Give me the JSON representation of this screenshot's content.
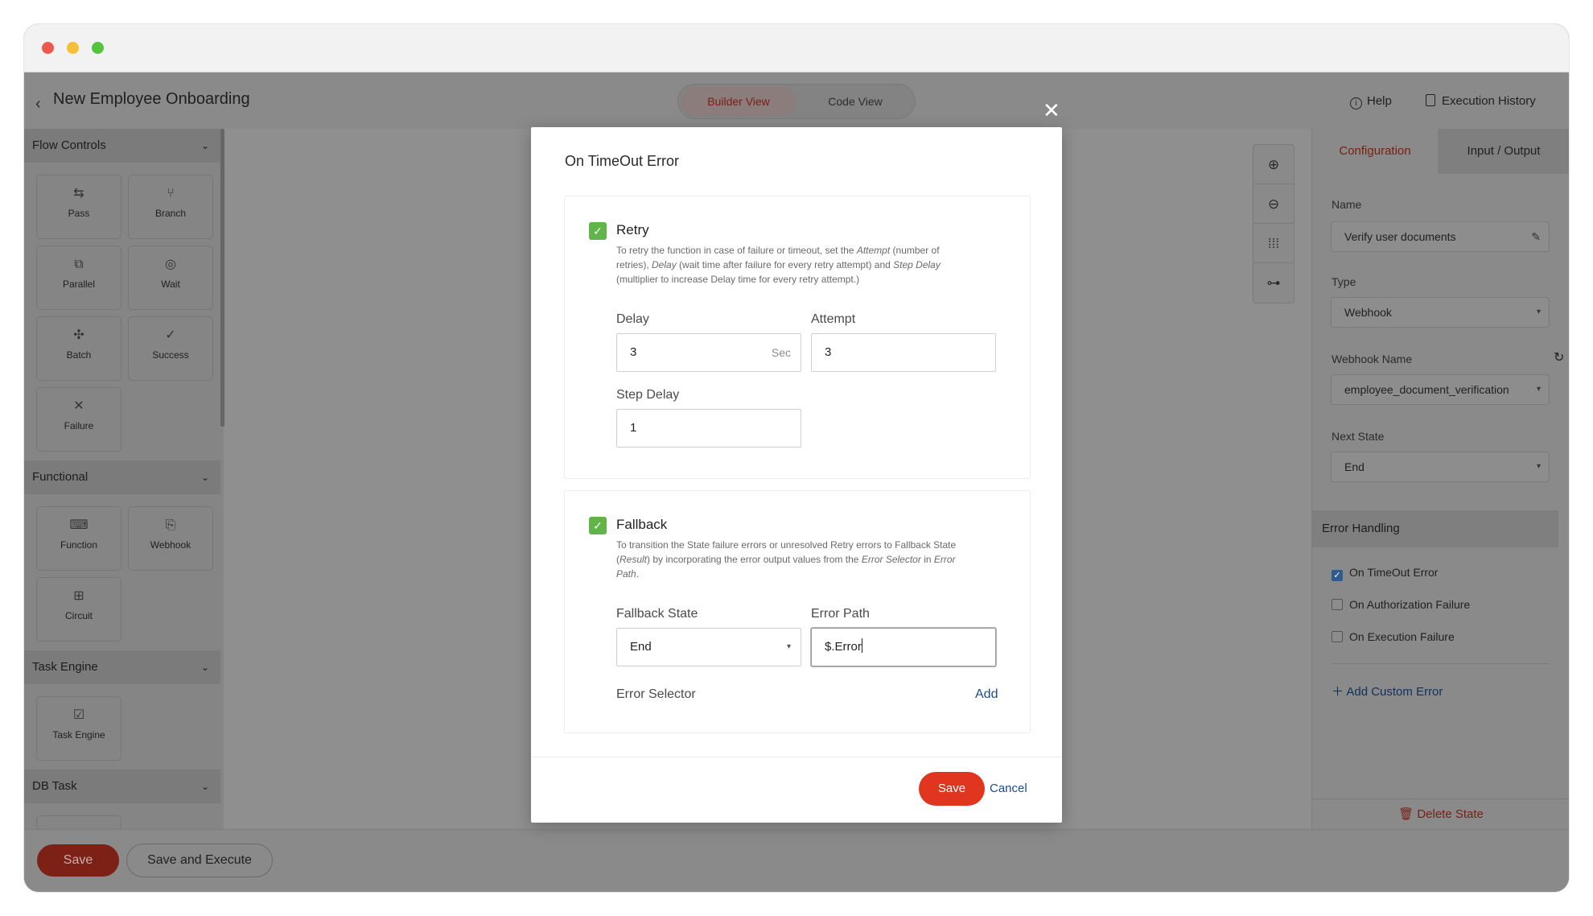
{
  "window": {
    "colors": {
      "close": "#ec5a4f",
      "minimize": "#f4bf3a",
      "maximize": "#56c33f"
    }
  },
  "header": {
    "back_icon": "chevron-left-icon",
    "title": "New Employee Onboarding",
    "view_tabs": [
      {
        "label": "Builder View",
        "active": true
      },
      {
        "label": "Code View",
        "active": false
      }
    ],
    "help_label": "Help",
    "history_label": "Execution History"
  },
  "sidebar": {
    "sections": [
      {
        "title": "Flow Controls",
        "items": [
          {
            "label": "Pass",
            "icon": "pass-icon"
          },
          {
            "label": "Branch",
            "icon": "branch-icon"
          },
          {
            "label": "Parallel",
            "icon": "parallel-icon"
          },
          {
            "label": "Wait",
            "icon": "wait-icon"
          },
          {
            "label": "Batch",
            "icon": "batch-icon"
          },
          {
            "label": "Success",
            "icon": "success-icon"
          },
          {
            "label": "Failure",
            "icon": "failure-icon"
          }
        ]
      },
      {
        "title": "Functional",
        "items": [
          {
            "label": "Function",
            "icon": "function-icon"
          },
          {
            "label": "Webhook",
            "icon": "webhook-icon"
          },
          {
            "label": "Circuit",
            "icon": "circuit-icon"
          }
        ]
      },
      {
        "title": "Task Engine",
        "items": [
          {
            "label": "Task Engine",
            "icon": "task-engine-icon"
          }
        ]
      },
      {
        "title": "DB Task",
        "items": []
      }
    ]
  },
  "zoom_tools": [
    "zoom-in-icon",
    "zoom-out-icon",
    "grid-icon",
    "tree-layout-icon"
  ],
  "right_panel": {
    "tabs": [
      {
        "label": "Configuration",
        "active": true
      },
      {
        "label": "Input / Output",
        "active": false
      }
    ],
    "name_label": "Name",
    "name_value": "Verify user documents",
    "type_label": "Type",
    "type_value": "Webhook",
    "webhook_label": "Webhook Name",
    "webhook_value": "employee_document_verification",
    "next_state_label": "Next State",
    "next_state_value": "End",
    "error_handling_title": "Error Handling",
    "errors": [
      {
        "label": "On TimeOut Error",
        "checked": true
      },
      {
        "label": "On Authorization Failure",
        "checked": false
      },
      {
        "label": "On Execution Failure",
        "checked": false
      }
    ],
    "add_custom_error": "Add Custom Error",
    "delete_state": "Delete State"
  },
  "footer": {
    "save_label": "Save",
    "save_execute_label": "Save and Execute"
  },
  "modal": {
    "title": "On TimeOut Error",
    "retry": {
      "title": "Retry",
      "checked": true,
      "desc_1": "To retry the function in case of failure or timeout, set the ",
      "desc_attempt": "Attempt",
      "desc_2": " (number of retries), ",
      "desc_delay": "Delay",
      "desc_3": " (wait time after failure for every retry attempt) and ",
      "desc_step_delay": "Step Delay",
      "desc_4": " (multiplier to increase Delay time for every retry attempt.)",
      "delay_label": "Delay",
      "delay_value": "3",
      "delay_suffix": "Sec",
      "attempt_label": "Attempt",
      "attempt_value": "3",
      "step_delay_label": "Step Delay",
      "step_delay_value": "1"
    },
    "fallback": {
      "title": "Fallback",
      "checked": true,
      "desc_1": "To transition the State failure errors or unresolved Retry errors to Fallback State (",
      "desc_result": "Result",
      "desc_2": ") by incorporating the error output values from the ",
      "desc_error_selector": "Error Selector",
      "desc_3": " in ",
      "desc_error_path": "Error Path",
      "desc_4": ".",
      "fallback_state_label": "Fallback State",
      "fallback_state_value": "End",
      "error_path_label": "Error Path",
      "error_path_value": "$.Error",
      "error_selector_label": "Error Selector",
      "add_label": "Add"
    },
    "save_label": "Save",
    "cancel_label": "Cancel"
  }
}
